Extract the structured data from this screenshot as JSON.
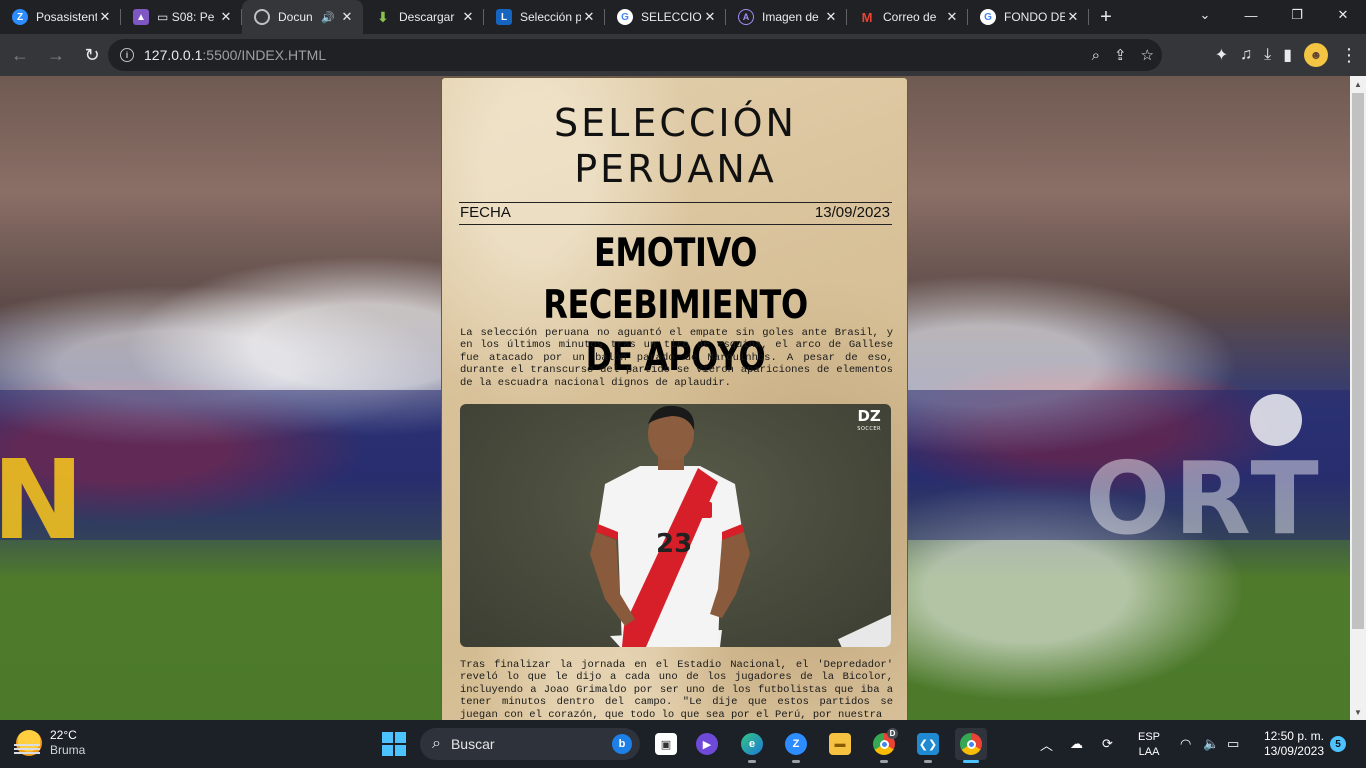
{
  "browser": {
    "tabs": [
      {
        "label": "Posasistente",
        "icon": "zoom-icon"
      },
      {
        "label": "S08: Pe",
        "icon": "meet-icon",
        "extra": "▭"
      },
      {
        "label": "Docun",
        "icon": "globe-icon",
        "active": true,
        "audio": "🔊"
      },
      {
        "label": "Descargar",
        "icon": "download-icon"
      },
      {
        "label": "Selección p",
        "icon": "l-site-icon"
      },
      {
        "label": "SELECCION",
        "icon": "google-icon"
      },
      {
        "label": "Imagen de",
        "icon": "ai-icon"
      },
      {
        "label": "Correo de",
        "icon": "gmail-icon"
      },
      {
        "label": "FONDO DE",
        "icon": "google-icon"
      }
    ],
    "new_tab": "+",
    "url_host": "127.0.0.1",
    "url_rest": ":5500/INDEX.HTML"
  },
  "article": {
    "title_line1": "SELECCIÓN",
    "title_line2": "PERUANA",
    "date_label": "FECHA",
    "date_value": "13/09/2023",
    "headline_line1": "EMOTIVO RECEBIMIENTO",
    "headline_line2": "DE APOYO",
    "paragraph1": "La selección peruana no aguantó el empate sin goles ante Brasil, y en los últimos minutos tras un tiro de esquina, el arco de Gallese fue atacado por un balón parado de Marquinhos. A pesar de eso, durante el transcurso del partido se vieron apariciones de elementos de la escuadra nacional dignos de aplaudir.",
    "paragraph2": "Tras finalizar la jornada en el Estadio Nacional, el 'Depredador' reveló lo que le dijo a cada uno de los jugadores de la Bicolor, incluyendo a Joao Grimaldo por ser uno de los futbolistas que iba a tener minutos dentro del campo. \"Le dije que estos partidos se juegan con el corazón, que todo lo que sea por el Perú, por nuestra",
    "photo_logo": "DZ",
    "photo_logo_sub": "SOCCER",
    "player_number": "23"
  },
  "background": {
    "left_letter": "N",
    "right_text": "ORT"
  },
  "taskbar": {
    "temperature": "22°C",
    "condition": "Bruma",
    "search_placeholder": "Buscar",
    "chrome_badge": "D",
    "lang_line1": "ESP",
    "lang_line2": "LAA",
    "time": "12:50 p. m.",
    "date": "13/09/2023",
    "notifications": "5"
  }
}
